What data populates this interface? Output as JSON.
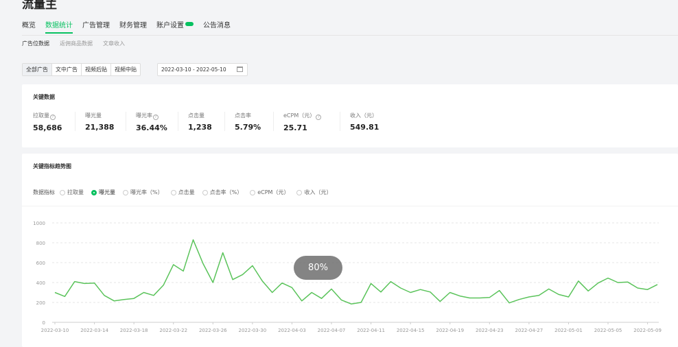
{
  "app": {
    "title": "流量主"
  },
  "main_nav": [
    {
      "label": "概览",
      "active": false
    },
    {
      "label": "数据统计",
      "active": true
    },
    {
      "label": "广告管理",
      "active": false
    },
    {
      "label": "财务管理",
      "active": false
    },
    {
      "label": "账户设置",
      "active": false,
      "badge": true
    },
    {
      "label": "公告消息",
      "active": false
    }
  ],
  "sub_nav": [
    {
      "label": "广告位数据",
      "active": true
    },
    {
      "label": "返佣商品数据",
      "active": false
    },
    {
      "label": "文章收入",
      "active": false
    }
  ],
  "ad_type_tabs": [
    {
      "label": "全部广告",
      "active": true
    },
    {
      "label": "文中广告",
      "active": false
    },
    {
      "label": "视频后贴",
      "active": false
    },
    {
      "label": "视频中贴",
      "active": false
    }
  ],
  "date_range": "2022-03-10 - 2022-05-10",
  "key_data": {
    "title": "关键数据",
    "metrics": [
      {
        "label": "拉取量",
        "value": "58,686",
        "help": true
      },
      {
        "label": "曝光量",
        "value": "21,388",
        "help": false
      },
      {
        "label": "曝光率",
        "value": "36.44%",
        "help": true
      },
      {
        "label": "点击量",
        "value": "1,238",
        "help": false
      },
      {
        "label": "点击率",
        "value": "5.79%",
        "help": false
      },
      {
        "label": "eCPM（元）",
        "value": "25.71",
        "help": true
      },
      {
        "label": "收入（元）",
        "value": "549.81",
        "help": false
      }
    ]
  },
  "trend": {
    "title": "关键指标趋势图",
    "metric_label": "数据指标",
    "options": [
      {
        "label": "拉取量",
        "checked": false
      },
      {
        "label": "曝光量",
        "checked": true
      },
      {
        "label": "曝光率（%）",
        "checked": false
      },
      {
        "label": "点击量",
        "checked": false
      },
      {
        "label": "点击率（%）",
        "checked": false
      },
      {
        "label": "eCPM（元）",
        "checked": false
      },
      {
        "label": "收入（元）",
        "checked": false
      }
    ]
  },
  "loading_text": "80%",
  "colors": {
    "accent": "#07c160",
    "line": "#5ac35a"
  },
  "chart_data": {
    "type": "line",
    "x_start": "2022-03-10",
    "x_end": "2022-05-10",
    "x_ticks": [
      "2022-03-10",
      "2022-03-14",
      "2022-03-18",
      "2022-03-22",
      "2022-03-26",
      "2022-03-30",
      "2022-04-03",
      "2022-04-07",
      "2022-04-11",
      "2022-04-15",
      "2022-04-19",
      "2022-04-23",
      "2022-04-27",
      "2022-05-01",
      "2022-05-05",
      "2022-05-09"
    ],
    "y_ticks": [
      0,
      200,
      400,
      600,
      800,
      1000
    ],
    "ylim": [
      0,
      1000
    ],
    "grid": true,
    "series": [
      {
        "values": [
          300,
          260,
          410,
          390,
          395,
          270,
          215,
          230,
          240,
          300,
          270,
          375,
          580,
          515,
          830,
          590,
          400,
          700,
          430,
          480,
          570,
          415,
          300,
          395,
          350,
          215,
          300,
          240,
          335,
          225,
          185,
          200,
          390,
          305,
          410,
          345,
          300,
          330,
          305,
          210,
          300,
          265,
          245,
          245,
          250,
          320,
          195,
          230,
          255,
          270,
          335,
          280,
          255,
          415,
          315,
          395,
          445,
          400,
          405,
          345,
          330,
          380
        ]
      }
    ]
  }
}
